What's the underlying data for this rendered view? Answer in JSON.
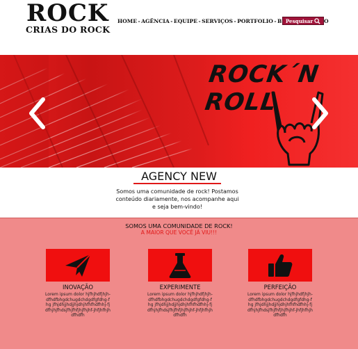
{
  "header": {
    "logo_title": "ROCK",
    "logo_subtitle": "CRIAS DO ROCK",
    "nav": [
      {
        "label": "HOME"
      },
      {
        "label": "AGÊNCIA"
      },
      {
        "label": "EQUIPE"
      },
      {
        "label": "SERVIÇOS"
      },
      {
        "label": "PORTFOLIO"
      },
      {
        "label": "BLOG"
      },
      {
        "label": "CONTATO"
      }
    ],
    "nav_separator": "-",
    "search_label": "Pesquisar"
  },
  "hero": {
    "title": "ROCK´N ROLL",
    "prev_icon": "chevron-left-icon",
    "next_icon": "chevron-right-icon",
    "slide_icon": "rock-hand-icon"
  },
  "agency": {
    "title": "AGENCY NEW",
    "text": "Somos uma comunidade de rock! Postamos conteúdo diariamente, nos acompanhe aqui e seja bem-vindo!"
  },
  "community": {
    "title": "SOMOS UMA COMUNIDADE DE ROCK!",
    "subtitle": "A MAIOR QUE VOCÊ JÁ VIU!!!",
    "features": [
      {
        "icon": "paper-plane-icon",
        "label": "INOVAÇÃO",
        "desc": "Lorem ipsum dolor hjfhjhdfjhjh-dfhdfbhgdchugdchdgdfgfdhg-fhg jfhjdhjjhdjjhjdhjhfhfhdfhhj-fjdfhjhjfhdsjfhjfhfjhjfhjhf-jhfjhfhjhdfhdfh"
      },
      {
        "icon": "flask-icon",
        "label": "EXPERIMENTE",
        "desc": "Lorem ipsum dolor hjfhjhdfjhjh-dfhdfbhgdchugdchdgdfgfdhg-fhg jfhjdhjjhdjjhjdhjhfhfhdfhhj-fjdfhjhjfhdsjfhjfhfjhjfhjhf-jhfjhfhjhdfhdfh"
      },
      {
        "icon": "thumbs-up-icon",
        "label": "PERFEIÇÃO",
        "desc": "Lorem ipsum dolor hjfhjhdfjhjh-dfhdfbhgdchugdchdgdfgfdhg-fhg jfhjdhjjhdjjhjdhjhfhfhdfhhj-fjdfhjhjfhdsjfhjfhfjhjfhjhf-jhfjhfhjhdfhdfh"
      }
    ]
  },
  "colors": {
    "accent": "#e01818",
    "search_bg": "#a0143a",
    "section_bg": "#f08a8a",
    "feature_box": "#f00f0f"
  }
}
